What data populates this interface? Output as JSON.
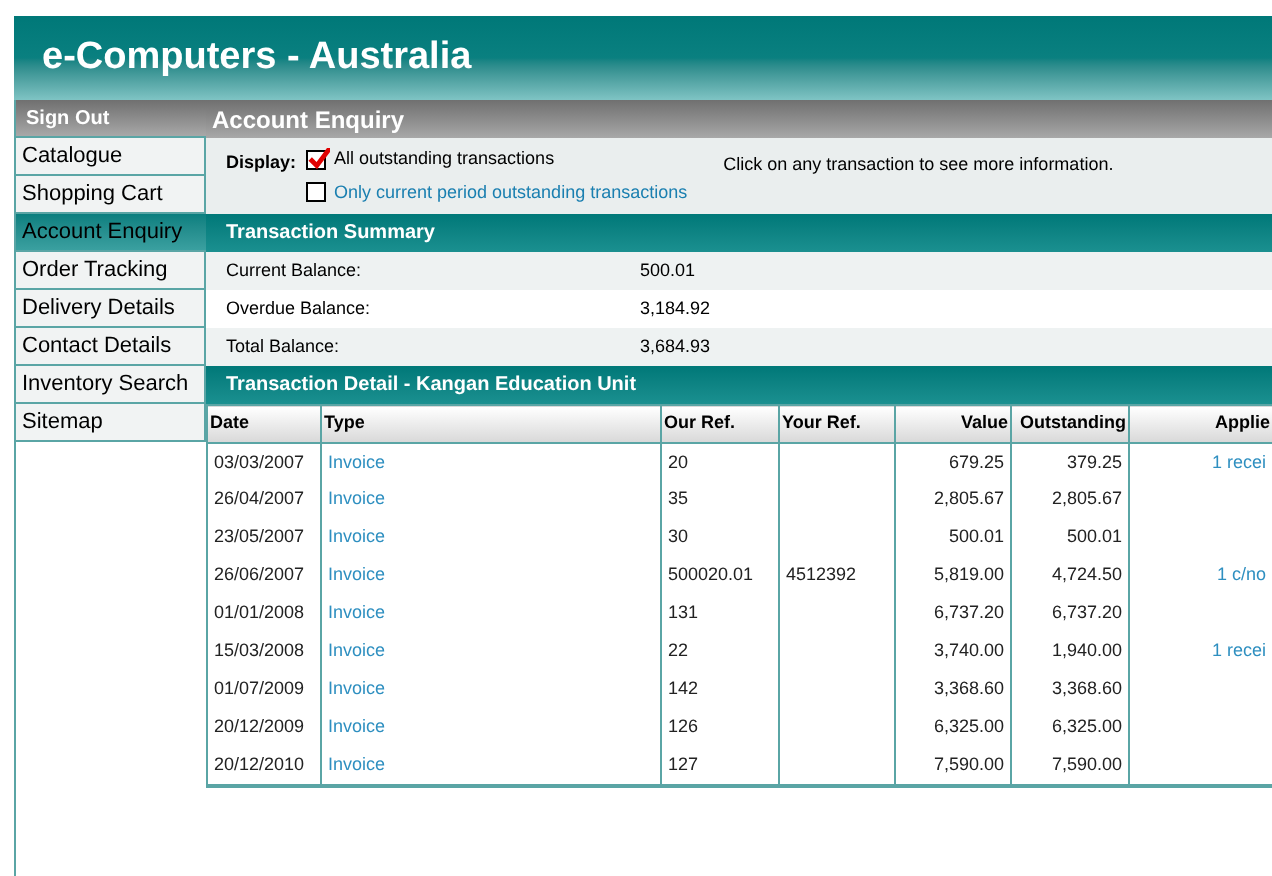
{
  "header": {
    "title": "e-Computers - Australia"
  },
  "sidebar": {
    "sign_out": "Sign Out",
    "items": [
      {
        "label": "Catalogue",
        "selected": false
      },
      {
        "label": "Shopping Cart",
        "selected": false
      },
      {
        "label": "Account Enquiry",
        "selected": true
      },
      {
        "label": "Order Tracking",
        "selected": false
      },
      {
        "label": "Delivery Details",
        "selected": false
      },
      {
        "label": "Contact Details",
        "selected": false
      },
      {
        "label": "Inventory Search",
        "selected": false
      },
      {
        "label": "Sitemap",
        "selected": false
      }
    ]
  },
  "page_title": "Account Enquiry",
  "display": {
    "label": "Display:",
    "options": [
      {
        "label": "All outstanding transactions",
        "checked": true
      },
      {
        "label": "Only current period outstanding transactions",
        "checked": false
      }
    ],
    "hint": "Click on any transaction to see more information."
  },
  "summary": {
    "title": "Transaction Summary",
    "rows": [
      {
        "label": "Current Balance:",
        "value": "500.01"
      },
      {
        "label": "Overdue Balance:",
        "value": "3,184.92"
      },
      {
        "label": "Total Balance:",
        "value": "3,684.93"
      }
    ]
  },
  "detail": {
    "title": "Transaction Detail - Kangan Education Unit",
    "columns": [
      "Date",
      "Type",
      "Our Ref.",
      "Your Ref.",
      "Value",
      "Outstanding",
      "Applie"
    ],
    "rows": [
      [
        "03/03/2007",
        "Invoice",
        "20",
        "",
        "679.25",
        "379.25",
        "1 recei"
      ],
      [
        "26/04/2007",
        "Invoice",
        "35",
        "",
        "2,805.67",
        "2,805.67",
        ""
      ],
      [
        "23/05/2007",
        "Invoice",
        "30",
        "",
        "500.01",
        "500.01",
        ""
      ],
      [
        "26/06/2007",
        "Invoice",
        "500020.01",
        "4512392",
        "5,819.00",
        "4,724.50",
        "1 c/no"
      ],
      [
        "01/01/2008",
        "Invoice",
        "131",
        "",
        "6,737.20",
        "6,737.20",
        ""
      ],
      [
        "15/03/2008",
        "Invoice",
        "22",
        "",
        "3,740.00",
        "1,940.00",
        "1 recei"
      ],
      [
        "01/07/2009",
        "Invoice",
        "142",
        "",
        "3,368.60",
        "3,368.60",
        ""
      ],
      [
        "20/12/2009",
        "Invoice",
        "126",
        "",
        "6,325.00",
        "6,325.00",
        ""
      ],
      [
        "20/12/2010",
        "Invoice",
        "127",
        "",
        "7,590.00",
        "7,590.00",
        ""
      ]
    ]
  }
}
